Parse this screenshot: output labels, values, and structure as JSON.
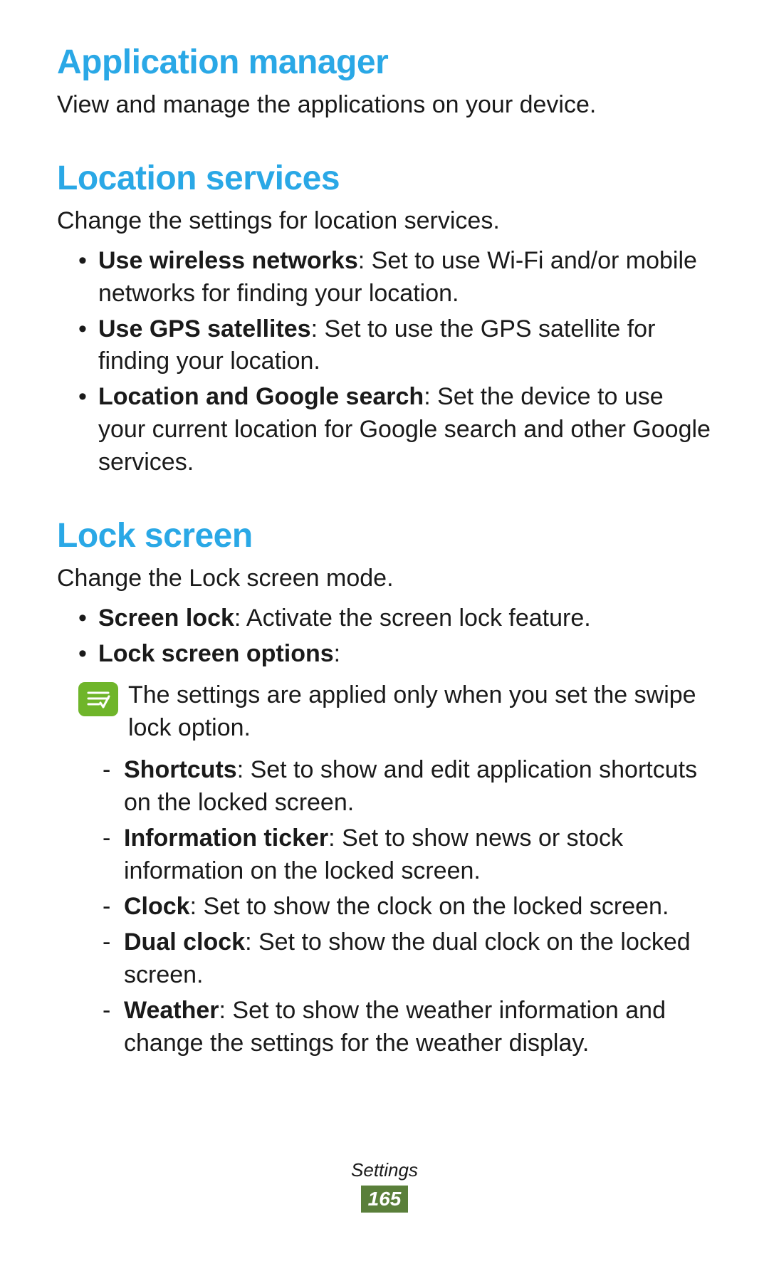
{
  "sections": {
    "app_manager": {
      "heading": "Application manager",
      "desc": "View and manage the applications on your device."
    },
    "location": {
      "heading": "Location services",
      "desc": "Change the settings for location services.",
      "items": [
        {
          "label": "Use wireless networks",
          "text": ": Set to use Wi-Fi and/or mobile networks for finding your location."
        },
        {
          "label": "Use GPS satellites",
          "text": ": Set to use the GPS satellite for finding your location."
        },
        {
          "label": "Location and Google search",
          "text": ": Set the device to use your current location for Google search and other Google services."
        }
      ]
    },
    "lock": {
      "heading": "Lock screen",
      "desc": "Change the Lock screen mode.",
      "items": [
        {
          "label": "Screen lock",
          "text": ": Activate the screen lock feature."
        },
        {
          "label": "Lock screen options",
          "text": ":"
        }
      ],
      "note": "The settings are applied only when you set the swipe lock option.",
      "subitems": [
        {
          "label": "Shortcuts",
          "text": ": Set to show and edit application shortcuts on the locked screen."
        },
        {
          "label": "Information ticker",
          "text": ": Set to show news or stock information on the locked screen."
        },
        {
          "label": "Clock",
          "text": ": Set to show the clock on the locked screen."
        },
        {
          "label": "Dual clock",
          "text": ": Set to show the dual clock on the locked screen."
        },
        {
          "label": "Weather",
          "text": ": Set to show the weather information and change the settings for the weather display."
        }
      ]
    }
  },
  "footer": {
    "category": "Settings",
    "page_number": "165"
  }
}
